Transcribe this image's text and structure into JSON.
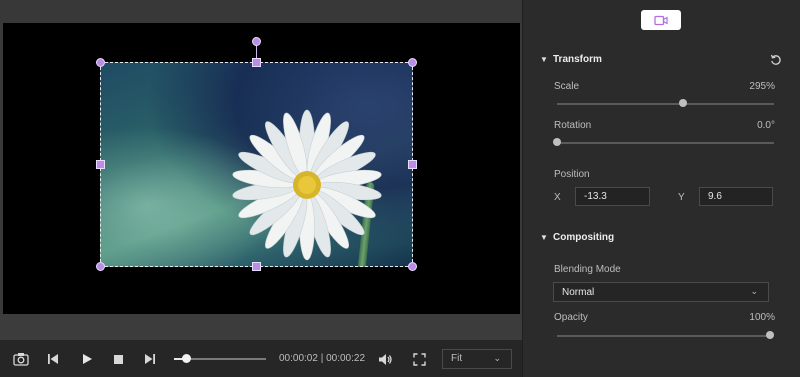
{
  "player": {
    "timecode": "00:00:02 | 00:00:22",
    "progress_fraction": 0.13,
    "fit_select": {
      "value": "Fit"
    }
  },
  "panel": {
    "transform": {
      "title": "Transform",
      "scale": {
        "label": "Scale",
        "value": "295%",
        "fraction": 0.58
      },
      "rotation": {
        "label": "Rotation",
        "value": "0.0°",
        "fraction": 0.0
      },
      "position": {
        "label": "Position",
        "x_label": "X",
        "x_value": "-13.3",
        "y_label": "Y",
        "y_value": "9.6"
      }
    },
    "compositing": {
      "title": "Compositing",
      "blending_mode": {
        "label": "Blending Mode",
        "value": "Normal"
      },
      "opacity": {
        "label": "Opacity",
        "value": "100%",
        "fraction": 1.0
      }
    }
  },
  "colors": {
    "accent": "#b98de8",
    "panel_bg": "#2b2b2b",
    "canvas_bg": "#000000"
  },
  "icons": {
    "video_tab": "video-camera-icon",
    "reset": "reset-icon",
    "snapshot": "camera-icon",
    "prev": "previous-frame-icon",
    "play": "play-icon",
    "stop": "stop-icon",
    "next": "next-frame-icon",
    "volume": "volume-icon",
    "fullscreen": "fullscreen-icon"
  }
}
